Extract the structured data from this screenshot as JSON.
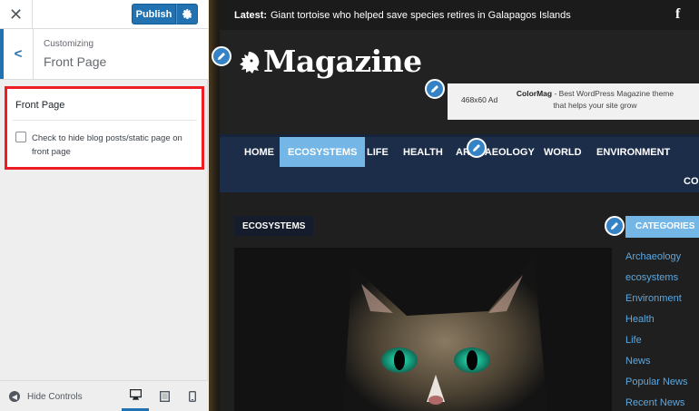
{
  "sidebar": {
    "close_icon": "close-icon",
    "publish_label": "Publish",
    "publish_settings_icon": "gear-icon",
    "back_icon": "chevron-left-icon",
    "customizing_label": "Customizing",
    "section_title": "Front Page",
    "control": {
      "title": "Front Page",
      "checkbox_label": "Check to hide blog posts/static page on front page",
      "checked": false
    },
    "footer": {
      "hide_controls_label": "Hide Controls",
      "devices": [
        "desktop",
        "tablet",
        "mobile"
      ],
      "selected_device": "desktop"
    }
  },
  "preview": {
    "topbar": {
      "latest_label": "Latest:",
      "latest_text": "Giant tortoise who helped save species retires in Galapagos Islands",
      "social_icon": "facebook-icon"
    },
    "logo_text": "Magazine",
    "ad": {
      "size": "468x60 Ad",
      "brand": "ColorMag",
      "text": " - Best WordPress Magazine theme that helps your site grow"
    },
    "nav": {
      "items": [
        "HOME",
        "ECOSYSTEMS",
        "LIFE",
        "HEALTH",
        "ARCHAEOLOGY",
        "WORLD",
        "ENVIRONMENT"
      ],
      "active": "ECOSYSTEMS",
      "overflow_item": "CO"
    },
    "category_tag": "ECOSYSTEMS",
    "categories_heading": "CATEGORIES",
    "categories": [
      "Archaeology",
      "ecosystems",
      "Environment",
      "Health",
      "Life",
      "News",
      "Popular News",
      "Recent News"
    ],
    "accent_color": "#74b7e6",
    "nav_color": "#1c2d4a"
  }
}
